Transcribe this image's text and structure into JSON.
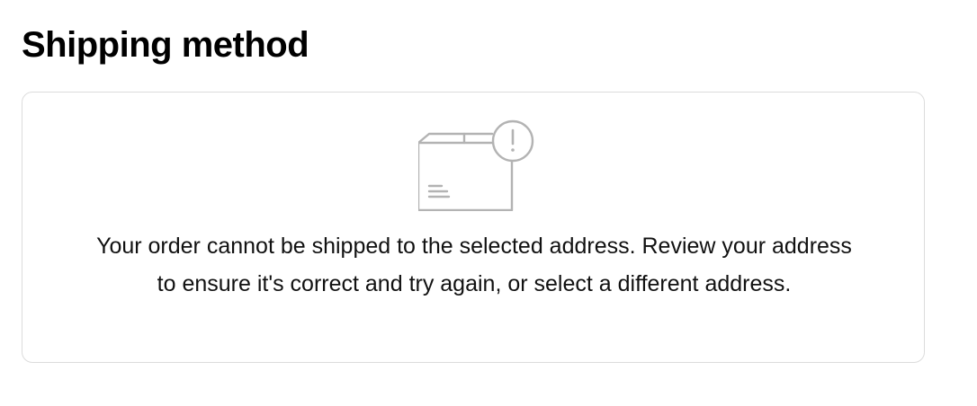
{
  "section": {
    "title": "Shipping method"
  },
  "notice": {
    "icon": "package-warning-icon",
    "message": "Your order cannot be shipped to the selected address. Review your address to ensure it's correct and try again, or select a different address."
  },
  "colors": {
    "card_border": "#dcdcdc",
    "icon_stroke": "#b3b3b3",
    "text": "#111111"
  }
}
